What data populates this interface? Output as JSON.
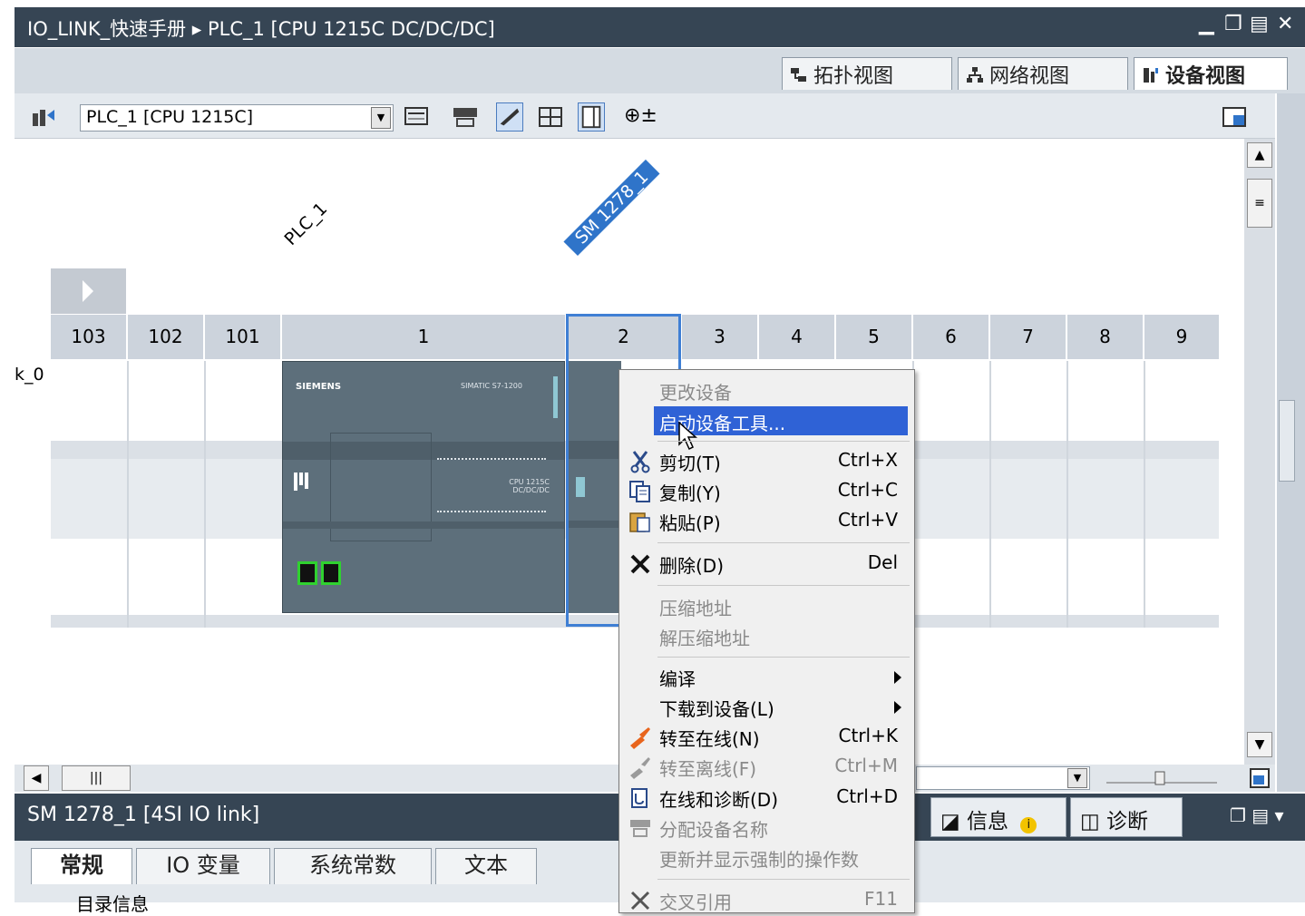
{
  "window": {
    "title": "IO_LINK_快速手册 ▸ PLC_1 [CPU 1215C DC/DC/DC]",
    "controls": [
      "▁",
      "❐",
      "▤",
      "✕"
    ]
  },
  "view_tabs": [
    {
      "label": "拓扑视图",
      "icon": "topology-view-icon",
      "active": false
    },
    {
      "label": "网络视图",
      "icon": "network-view-icon",
      "active": false
    },
    {
      "label": "设备视图",
      "icon": "device-view-icon",
      "active": true
    }
  ],
  "toolbar": {
    "device_select": "PLC_1 [CPU 1215C]",
    "zoom_glyph": "⊕±"
  },
  "canvas": {
    "plc_label": "PLC_1",
    "module_label": "SM 1278_1",
    "edge_text": "k_0",
    "slots": [
      "103",
      "102",
      "101",
      "1",
      "2",
      "3",
      "4",
      "5",
      "6",
      "7",
      "8",
      "9"
    ],
    "cpu_brand": "SIEMENS",
    "cpu_series": "SIMATIC S7-1200",
    "cpu_model": "CPU 1215C DC/DC/DC"
  },
  "context_menu": {
    "items": [
      {
        "label": "更改设备",
        "shortcut": "",
        "disabled": true,
        "icon": ""
      },
      {
        "label": "启动设备工具...",
        "shortcut": "",
        "highlighted": true,
        "icon": ""
      },
      {
        "label": "剪切(T)",
        "shortcut": "Ctrl+X",
        "icon": "cut-icon"
      },
      {
        "label": "复制(Y)",
        "shortcut": "Ctrl+C",
        "icon": "copy-icon"
      },
      {
        "label": "粘贴(P)",
        "shortcut": "Ctrl+V",
        "icon": "paste-icon"
      },
      {
        "label": "删除(D)",
        "shortcut": "Del",
        "icon": "delete-icon"
      },
      {
        "label": "压缩地址",
        "shortcut": "",
        "disabled": true,
        "icon": ""
      },
      {
        "label": "解压缩地址",
        "shortcut": "",
        "disabled": true,
        "icon": ""
      },
      {
        "label": "编译",
        "shortcut": "",
        "submenu": true,
        "icon": ""
      },
      {
        "label": "下载到设备(L)",
        "shortcut": "",
        "submenu": true,
        "icon": ""
      },
      {
        "label": "转至在线(N)",
        "shortcut": "Ctrl+K",
        "icon": "go-online-icon"
      },
      {
        "label": "转至离线(F)",
        "shortcut": "Ctrl+M",
        "disabled": true,
        "icon": "go-offline-icon"
      },
      {
        "label": "在线和诊断(D)",
        "shortcut": "Ctrl+D",
        "icon": "online-diagnostics-icon"
      },
      {
        "label": "分配设备名称",
        "shortcut": "",
        "disabled": true,
        "icon": "assign-name-icon"
      },
      {
        "label": "更新并显示强制的操作数",
        "shortcut": "",
        "disabled": true,
        "icon": ""
      },
      {
        "label": "交叉引用",
        "shortcut": "F11",
        "disabled": true,
        "icon": "cross-reference-icon"
      }
    ]
  },
  "bottom_panel": {
    "title": "SM 1278_1 [4SI IO link]",
    "right_tabs": [
      {
        "label": "信息",
        "icon": "info-icon"
      },
      {
        "label": "诊断",
        "icon": "diagnostics-icon"
      }
    ],
    "property_tabs": [
      "常规",
      "IO 变量",
      "系统常数",
      "文本"
    ],
    "partial_text": "目录信息"
  },
  "colors": {
    "title_bar": "#364554",
    "selection": "#3f7fd4",
    "menu_highlight": "#2f62d6",
    "module_body": "#5d6f7b"
  }
}
